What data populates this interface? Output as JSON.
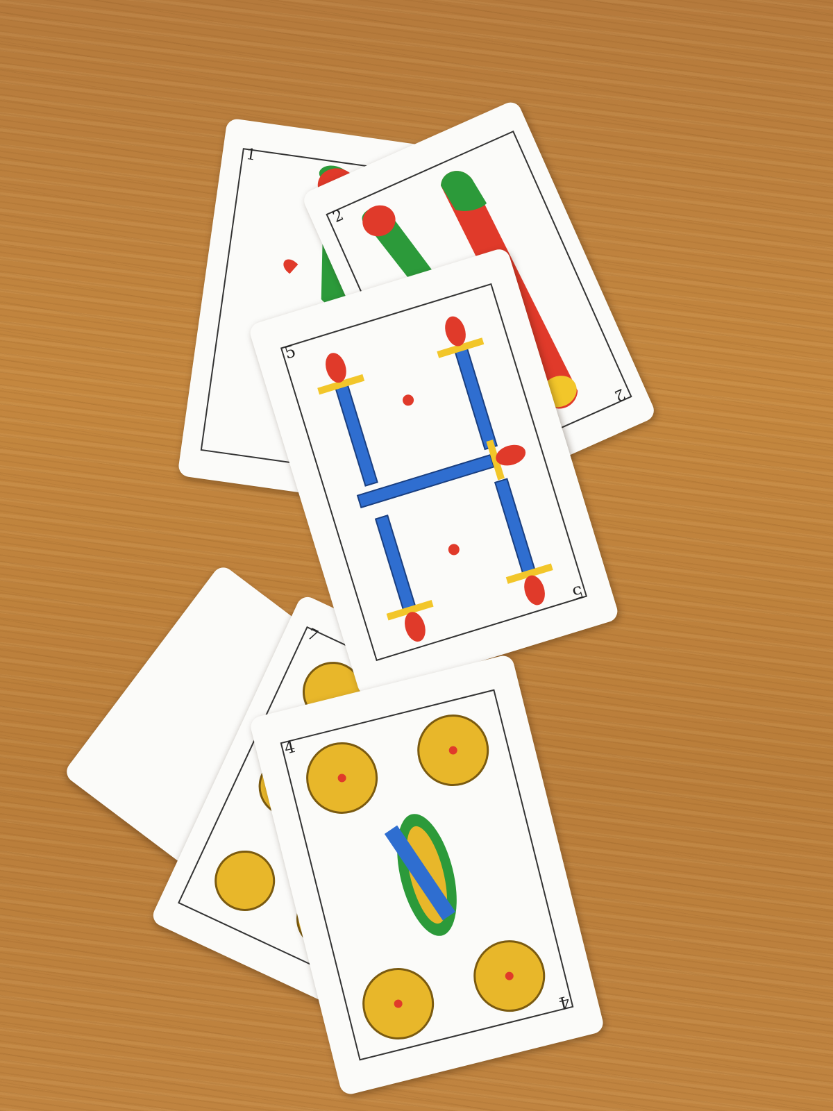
{
  "scene": {
    "surface": "wooden-table",
    "surface_color": "#bf8440",
    "deck": "spanish-playing-cards",
    "cards": [
      {
        "id": "one-of-clubs",
        "suit": "bastos",
        "rank_label": "1"
      },
      {
        "id": "two-of-clubs",
        "suit": "bastos",
        "rank_label": "2"
      },
      {
        "id": "five-of-swords",
        "suit": "espadas",
        "rank_label": "5"
      },
      {
        "id": "seven-of-coins",
        "suit": "oros",
        "rank_label": "7"
      },
      {
        "id": "four-of-coins",
        "suit": "oros",
        "rank_label": "4"
      },
      {
        "id": "hidden-back-card",
        "suit": "unknown",
        "rank_label": ""
      }
    ]
  },
  "colors": {
    "coin": "#e8b72a",
    "coin_dark": "#7a5a10",
    "sword_blade": "#2f6ed0",
    "sword_hilt": "#f2c62a",
    "club_green": "#2c9a3a",
    "club_red": "#e03a2a"
  }
}
